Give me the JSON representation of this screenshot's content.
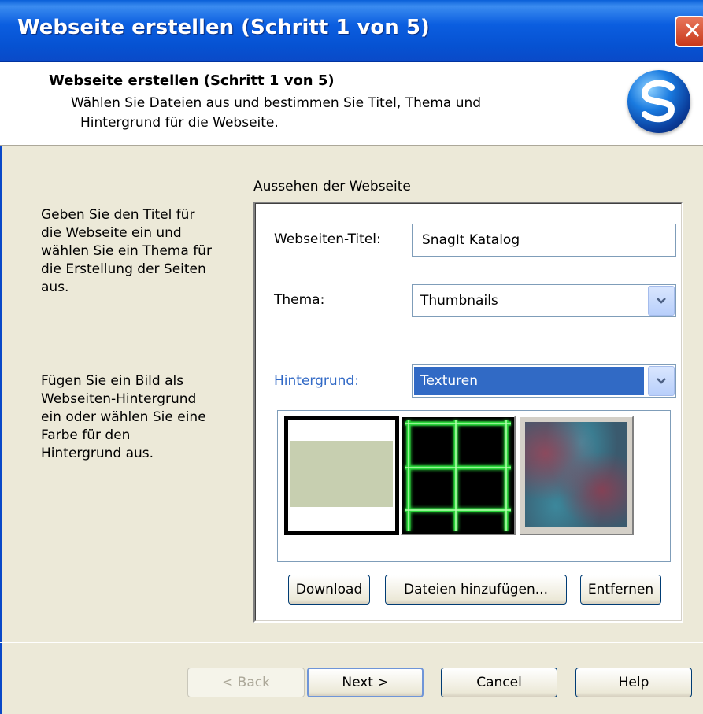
{
  "window": {
    "title": "Webseite erstellen (Schritt 1 von 5)",
    "close_glyph": "✕"
  },
  "header": {
    "title": "Webseite erstellen (Schritt 1 von 5)",
    "description_line1": "Wählen Sie Dateien aus und bestimmen Sie Titel, Thema und",
    "description_line2": "Hintergrund für die Webseite.",
    "logo_icon": "snagit-logo-icon"
  },
  "help": {
    "paragraph1": [
      "Geben Sie den Titel für",
      "die Webseite ein und",
      "wählen Sie ein Thema für",
      "die Erstellung der Seiten",
      "aus."
    ],
    "paragraph2": [
      "Fügen Sie ein Bild als",
      "Webseiten-Hintergrund",
      "ein oder wählen Sie eine",
      "Farbe für den",
      "Hintergrund aus."
    ]
  },
  "appearance": {
    "group_label": "Aussehen der Webseite",
    "title_label": "Webseiten-Titel:",
    "title_value": "SnagIt Katalog",
    "theme_label": "Thema:",
    "theme_value": "Thumbnails",
    "background_label": "Hintergrund:",
    "background_value": "Texturen",
    "swatches": [
      "light-green-solid",
      "green-neon-grid",
      "red-teal-texture"
    ],
    "selected_swatch": 0,
    "download_button": "Download",
    "add_files_button": "Dateien hinzufügen...",
    "remove_button": "Entfernen"
  },
  "footer": {
    "back_button": "< Back",
    "next_button": "Next >",
    "cancel_button": "Cancel",
    "help_button": "Help"
  },
  "colors": {
    "titlebar": "#0a5fd8",
    "dialog_bg": "#ece9d8",
    "selection": "#316ac5",
    "link_label": "#3169c6"
  }
}
